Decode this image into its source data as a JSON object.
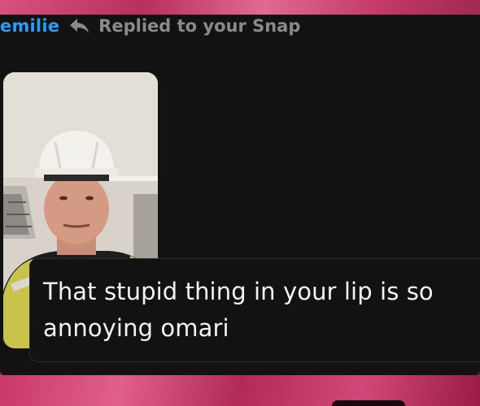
{
  "header": {
    "sender_name": "emilie",
    "reply_icon": "reply-arrow-icon",
    "reply_label": "Replied to your Snap"
  },
  "snap": {
    "thumbnail": "snap-photo-thumbnail"
  },
  "message": {
    "text": "That stupid thing in your lip is so annoying omari"
  },
  "colors": {
    "sender": "#2f9af2",
    "reply_label": "#8a8a8a",
    "card_background": "#121212",
    "message_text": "#f2f2f2"
  }
}
